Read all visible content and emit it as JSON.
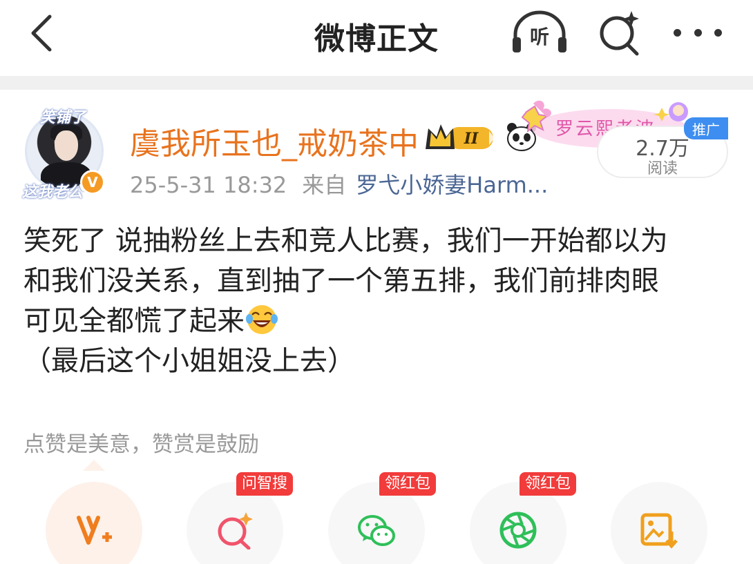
{
  "nav": {
    "title": "微博正文",
    "listen_label": "听"
  },
  "post": {
    "author": {
      "name": "虞我所玉也_戒奶茶中",
      "avatar_frame_top": "笑铺了",
      "avatar_frame_bottom": "这我老公",
      "verified_mark": "V",
      "member_level": "II",
      "fan_banner": "罗云熙老波"
    },
    "time": "25-5-31 18:32",
    "from_label": "来自",
    "source": "罗弋小娇妻Harm...",
    "promo_tag": "推广",
    "read_count": "2.7万",
    "read_label": "阅读",
    "body_lines": [
      "笑死了 说抽粉丝上去和竞人比赛，我们一开始都以为",
      "和我们没关系，直到抽了一个第五排，我们前排肉眼",
      "可见全都慌了起来",
      "（最后这个小姐姐没上去）"
    ],
    "reward_note": "点赞是美意，赞赏是鼓励"
  },
  "actions": [
    {
      "name": "vplus",
      "icon": "vplus-icon",
      "badge": ""
    },
    {
      "name": "ask-search",
      "icon": "search-sparkle-icon",
      "badge": "问智搜"
    },
    {
      "name": "wechat",
      "icon": "wechat-icon",
      "badge": "领红包"
    },
    {
      "name": "moments",
      "icon": "moments-icon",
      "badge": "领红包"
    },
    {
      "name": "save-image",
      "icon": "image-download-icon",
      "badge": ""
    }
  ],
  "colors": {
    "username": "#e8731e",
    "source_link": "#4b6694",
    "badge_red": "#f23b3b",
    "promo_blue": "#3d8ef0",
    "wechat_green": "#2fbf5a"
  }
}
